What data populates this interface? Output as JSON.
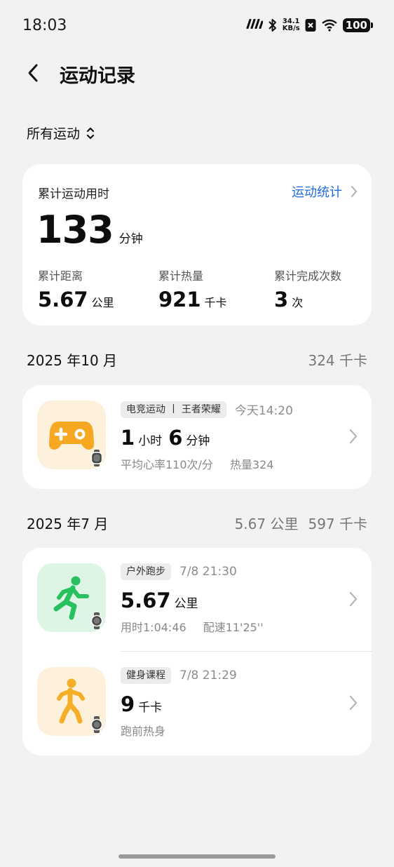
{
  "status_bar": {
    "time": "18:03",
    "signal_label": "m",
    "net_speed_value": "34.1",
    "net_speed_unit": "KB/s",
    "battery": "100",
    "icons": [
      "hd-signal-icon",
      "bluetooth-icon",
      "netspeed",
      "close-box-icon",
      "wifi-icon",
      "battery-icon"
    ]
  },
  "header": {
    "title": "运动记录",
    "back_icon": "chevron-left-icon"
  },
  "filter": {
    "label": "所有运动",
    "icon": "sort-updown-icon"
  },
  "summary": {
    "title": "累计运动用时",
    "link_label": "运动统计",
    "total_value": "133",
    "total_unit": "分钟",
    "metrics": [
      {
        "label": "累计距离",
        "value": "5.67",
        "unit": "公里"
      },
      {
        "label": "累计热量",
        "value": "921",
        "unit": "千卡"
      },
      {
        "label": "累计完成次数",
        "value": "3",
        "unit": "次"
      }
    ]
  },
  "months": [
    {
      "label": "2025 年10 月",
      "totals": [
        "324 千卡"
      ],
      "activities": [
        {
          "tag": "电竞运动 丨 王者荣耀",
          "time": "今天14:20",
          "main": [
            {
              "v": "1",
              "u": "小时"
            },
            {
              "v": "6",
              "u": "分钟"
            }
          ],
          "sub": [
            "平均心率110次/分",
            "热量324"
          ],
          "icon": "gamepad-icon",
          "icon_bg": "#fdf1dc",
          "icon_color": "#f7a823"
        }
      ]
    },
    {
      "label": "2025 年7 月",
      "totals": [
        "5.67 公里",
        "597 千卡"
      ],
      "activities": [
        {
          "tag": "户外跑步",
          "time": "7/8 21:30",
          "main": [
            {
              "v": "5.67",
              "u": "公里"
            }
          ],
          "sub": [
            "用时1:04:46",
            "配速11'25''"
          ],
          "icon": "running-icon",
          "icon_bg": "#def5e6",
          "icon_color": "#27c15f"
        },
        {
          "tag": "健身课程",
          "time": "7/8 21:29",
          "main": [
            {
              "v": "9",
              "u": "千卡"
            }
          ],
          "sub": [
            "跑前热身"
          ],
          "icon": "warmup-icon",
          "icon_bg": "#fdf1dc",
          "icon_color": "#f5ae25"
        }
      ]
    }
  ]
}
